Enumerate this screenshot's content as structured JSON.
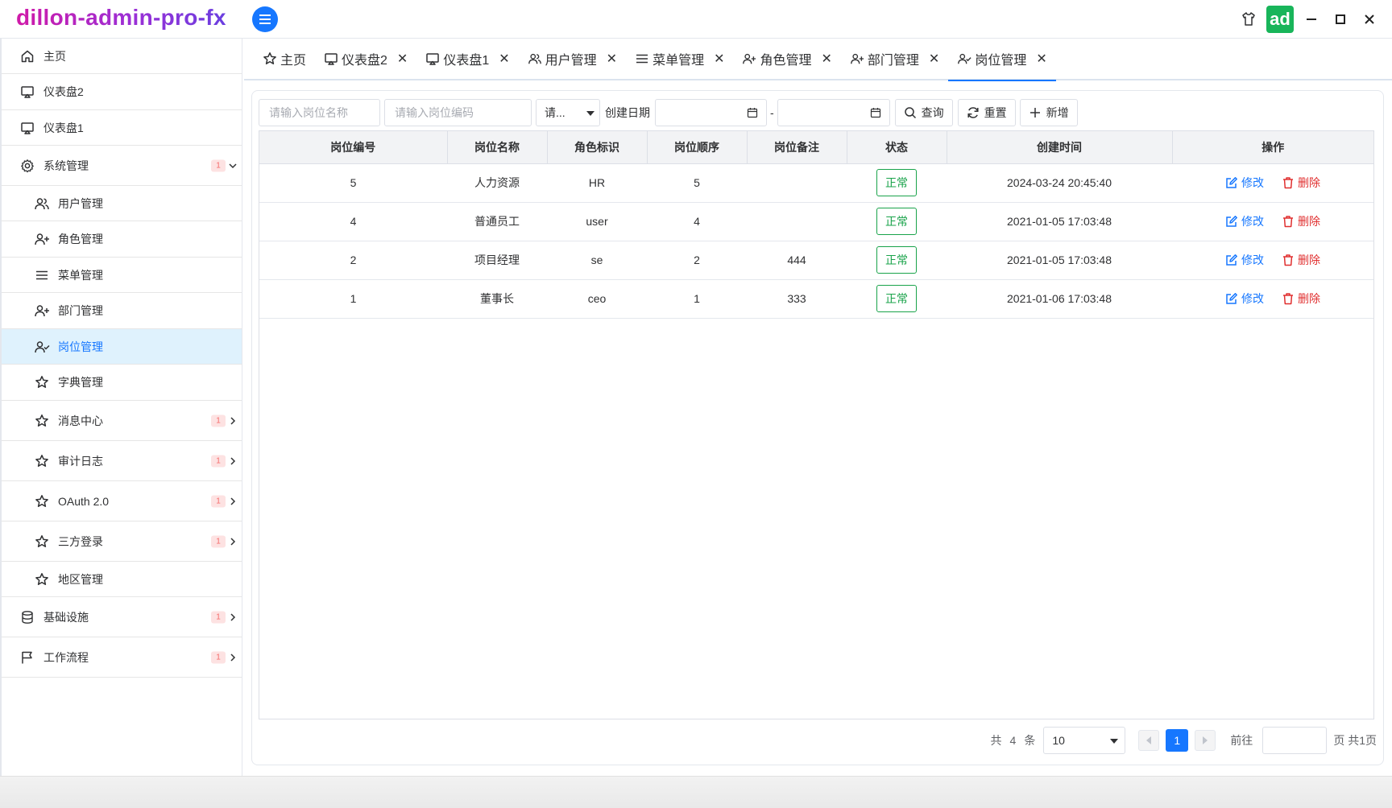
{
  "app": {
    "title": "dillon-admin-pro-fx",
    "avatar_text": "ad",
    "accent_color": "#1677ff",
    "avatar_color": "#18b55a"
  },
  "sidebar": {
    "items": [
      {
        "label": "主页",
        "icon": "home-icon"
      },
      {
        "label": "仪表盘2",
        "icon": "monitor-icon"
      },
      {
        "label": "仪表盘1",
        "icon": "monitor-icon"
      },
      {
        "label": "系统管理",
        "icon": "gear-icon",
        "badge": "1",
        "expanded": true
      },
      {
        "label": "用户管理",
        "icon": "users-icon"
      },
      {
        "label": "角色管理",
        "icon": "user-plus-icon"
      },
      {
        "label": "菜单管理",
        "icon": "list-icon"
      },
      {
        "label": "部门管理",
        "icon": "user-plus-icon"
      },
      {
        "label": "岗位管理",
        "icon": "user-check-icon",
        "active": true
      },
      {
        "label": "字典管理",
        "icon": "star-icon"
      },
      {
        "label": "消息中心",
        "icon": "star-icon",
        "badge": "1"
      },
      {
        "label": "审计日志",
        "icon": "star-icon",
        "badge": "1"
      },
      {
        "label": "OAuth 2.0",
        "icon": "star-icon",
        "badge": "1"
      },
      {
        "label": "三方登录",
        "icon": "star-icon",
        "badge": "1"
      },
      {
        "label": "地区管理",
        "icon": "star-icon"
      },
      {
        "label": "基础设施",
        "icon": "database-icon",
        "badge": "1"
      },
      {
        "label": "工作流程",
        "icon": "flag-icon",
        "badge": "1"
      }
    ]
  },
  "tabs": [
    {
      "label": "主页",
      "icon": "star-icon",
      "closable": false
    },
    {
      "label": "仪表盘2",
      "icon": "monitor-icon",
      "closable": true
    },
    {
      "label": "仪表盘1",
      "icon": "monitor-icon",
      "closable": true
    },
    {
      "label": "用户管理",
      "icon": "users-icon",
      "closable": true
    },
    {
      "label": "菜单管理",
      "icon": "list-icon",
      "closable": true
    },
    {
      "label": "角色管理",
      "icon": "user-plus-icon",
      "closable": true
    },
    {
      "label": "部门管理",
      "icon": "user-plus-icon",
      "closable": true
    },
    {
      "label": "岗位管理",
      "icon": "user-check-icon",
      "closable": true,
      "active": true
    }
  ],
  "tab_close_glyph": "✕",
  "filters": {
    "post_name_placeholder": "请输入岗位名称",
    "post_code_placeholder": "请输入岗位编码",
    "status_select": "请...",
    "date_label": "创建日期",
    "date_separator": "-",
    "search_label": "查询",
    "reset_label": "重置",
    "add_label": "新增"
  },
  "table": {
    "columns": [
      "岗位编号",
      "岗位名称",
      "角色标识",
      "岗位顺序",
      "岗位备注",
      "状态",
      "创建时间",
      "操作"
    ],
    "rows": [
      {
        "id": "5",
        "name": "人力资源",
        "code": "HR",
        "order": "5",
        "remark": "",
        "status": "正常",
        "created": "2024-03-24 20:45:40"
      },
      {
        "id": "4",
        "name": "普通员工",
        "code": "user",
        "order": "4",
        "remark": "",
        "status": "正常",
        "created": "2021-01-05 17:03:48"
      },
      {
        "id": "2",
        "name": "项目经理",
        "code": "se",
        "order": "2",
        "remark": "444",
        "status": "正常",
        "created": "2021-01-05 17:03:48"
      },
      {
        "id": "1",
        "name": "董事长",
        "code": "ceo",
        "order": "1",
        "remark": "333",
        "status": "正常",
        "created": "2021-01-06 17:03:48"
      }
    ],
    "edit_label": "修改",
    "delete_label": "删除"
  },
  "pagination": {
    "total_prefix": "共",
    "total": "4",
    "total_suffix": "条",
    "page_size": "10",
    "current_page": "1",
    "goto_label": "前往",
    "page_suffix": "页 共1页"
  }
}
